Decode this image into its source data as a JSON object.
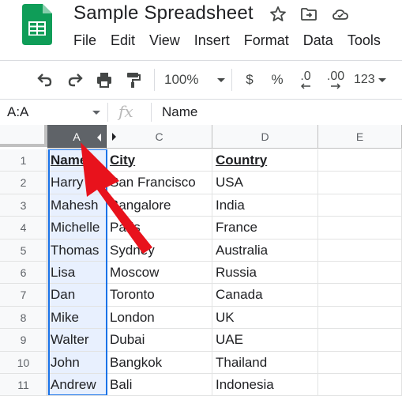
{
  "app": {
    "doc_title": "Sample Spreadsheet",
    "menu": [
      "File",
      "Edit",
      "View",
      "Insert",
      "Format",
      "Data",
      "Tools"
    ]
  },
  "toolbar": {
    "zoom": "100%",
    "currency": "$",
    "percent": "%",
    "decrease_decimal": ".0",
    "increase_decimal": ".00",
    "more_formats": "123"
  },
  "formula_bar": {
    "name_box": "A:A",
    "fx_label": "fx",
    "value": "Name"
  },
  "grid": {
    "columns": [
      "A",
      "C",
      "D",
      "E"
    ],
    "row_numbers": [
      "1",
      "2",
      "3",
      "4",
      "5",
      "6",
      "7",
      "8",
      "9",
      "10",
      "11"
    ],
    "rows": [
      [
        "Name",
        "City",
        "Country",
        ""
      ],
      [
        "Harry",
        "San Francisco",
        "USA",
        ""
      ],
      [
        "Mahesh",
        "Bangalore",
        "India",
        ""
      ],
      [
        "Michelle",
        "Paris",
        "France",
        ""
      ],
      [
        "Thomas",
        "Sydney",
        "Australia",
        ""
      ],
      [
        "Lisa",
        "Moscow",
        "Russia",
        ""
      ],
      [
        "Dan",
        "Toronto",
        "Canada",
        ""
      ],
      [
        "Mike",
        "London",
        "UK",
        ""
      ],
      [
        "Walter",
        "Dubai",
        "UAE",
        ""
      ],
      [
        "John",
        "Bangkok",
        "Thailand",
        ""
      ],
      [
        "Andrew",
        "Bali",
        "Indonesia",
        ""
      ]
    ]
  },
  "colors": {
    "selected_column_header": "#5f6368",
    "selected_column_fill": "#e8f0fe",
    "selection_border": "#1a73e8",
    "annotation_arrow": "#e8121c",
    "logo_green": "#0f9d58"
  }
}
